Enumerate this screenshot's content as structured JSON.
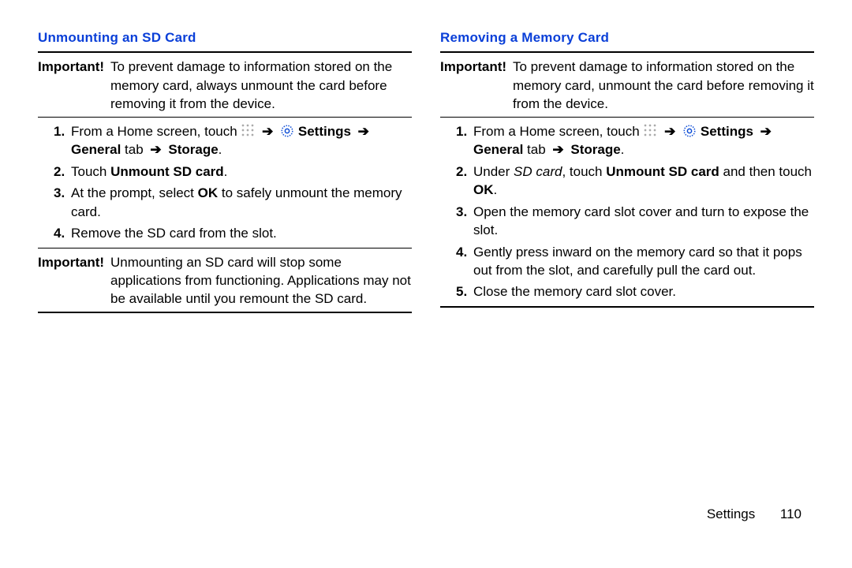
{
  "left": {
    "heading": "Unmounting an SD Card",
    "topImportant": {
      "label": "Important!",
      "text": "To prevent damage to information stored on the memory card, always unmount the card before removing it from the device."
    },
    "steps": [
      {
        "num": "1.",
        "prefix": "From a Home screen, touch ",
        "arrow1": "➔",
        "settings": "Settings",
        "arrow2": " ➔ ",
        "mid": "General",
        "mid2": " tab ",
        "arrow3": "➔ ",
        "storage": "Storage",
        "tail": "."
      },
      {
        "num": "2.",
        "prefix": "Touch ",
        "bold": "Unmount SD card",
        "tail": "."
      },
      {
        "num": "3.",
        "prefix": "At the prompt, select ",
        "bold": "OK",
        "tail": " to safely unmount the memory card."
      },
      {
        "num": "4.",
        "plain": "Remove the SD card from the slot."
      }
    ],
    "bottomImportant": {
      "label": "Important!",
      "text": "Unmounting an SD card will stop some applications from functioning. Applications may not be available until you remount the SD card."
    }
  },
  "right": {
    "heading": "Removing a Memory Card",
    "topImportant": {
      "label": "Important!",
      "text": "To prevent damage to information stored on the memory card, unmount the card before removing it from the device."
    },
    "steps": [
      {
        "num": "1.",
        "prefix": "From a Home screen, touch ",
        "arrow1": "➔",
        "settings": "Settings",
        "arrow2": " ➔ ",
        "mid": "General",
        "mid2": " tab ",
        "arrow3": "➔ ",
        "storage": "Storage",
        "tail": "."
      },
      {
        "num": "2.",
        "prefix": "Under ",
        "italic": "SD card",
        "mid": ", touch ",
        "bold": "Unmount SD card",
        "mid2": " and then touch ",
        "bold2": "OK",
        "tail": "."
      },
      {
        "num": "3.",
        "plain": "Open the memory card slot cover and turn to expose the slot."
      },
      {
        "num": "4.",
        "plain": "Gently press inward on the memory card so that it pops out from the slot, and carefully pull the card out."
      },
      {
        "num": "5.",
        "plain": "Close the memory card slot cover."
      }
    ]
  },
  "footer": {
    "section": "Settings",
    "page": "110"
  }
}
